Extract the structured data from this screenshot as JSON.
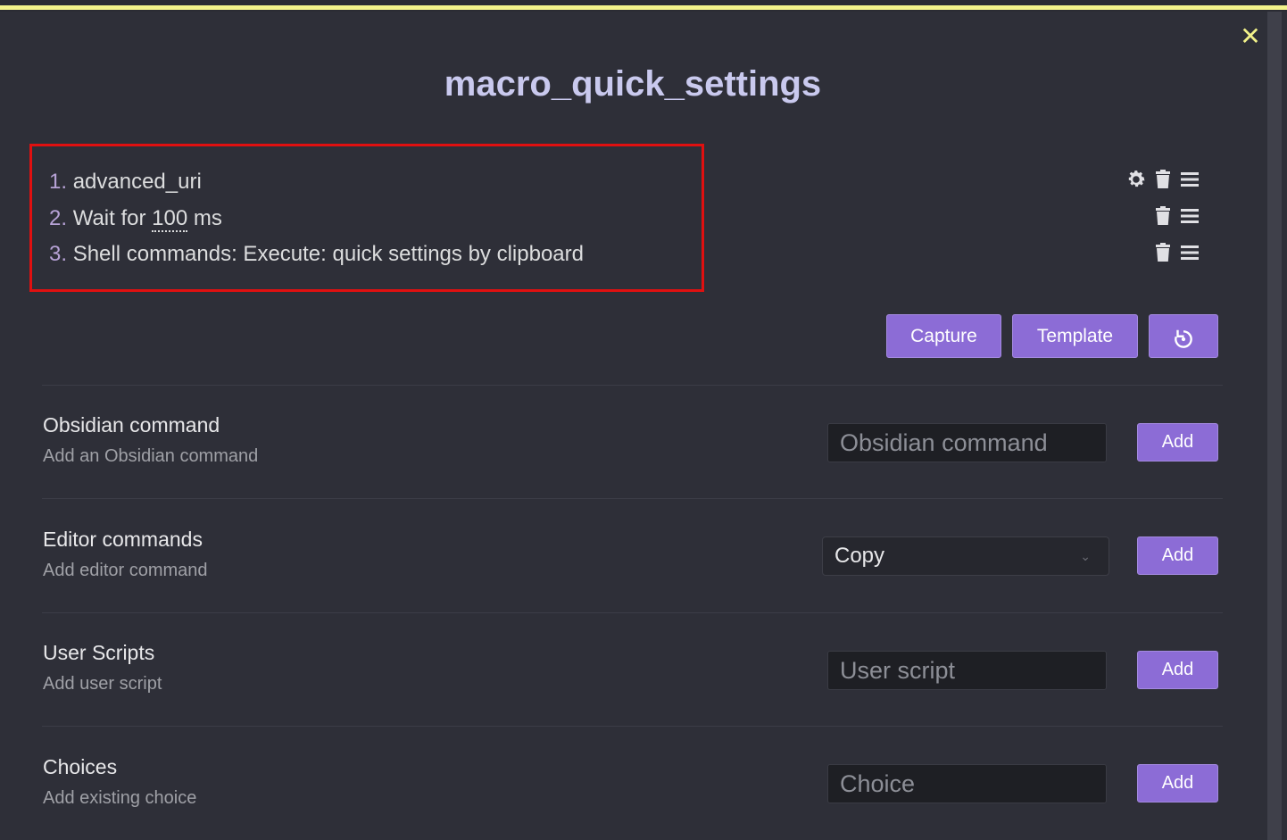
{
  "modal": {
    "title": "macro_quick_settings",
    "close_glyph": "✕"
  },
  "commands": [
    {
      "number": "1.",
      "text": "advanced_uri",
      "icons": [
        "gear-icon",
        "trash-icon",
        "drag-handle-icon"
      ]
    },
    {
      "number": "2.",
      "prefix": "Wait for ",
      "value": "100",
      "suffix": " ms",
      "icons": [
        "trash-icon",
        "drag-handle-icon"
      ]
    },
    {
      "number": "3.",
      "text": "Shell commands: Execute: quick settings by clipboard",
      "icons": [
        "trash-icon",
        "drag-handle-icon"
      ]
    }
  ],
  "actions": {
    "capture": "Capture",
    "template": "Template",
    "rotate_icon": "rotate-icon"
  },
  "settings": {
    "obsidian": {
      "name": "Obsidian command",
      "desc": "Add an Obsidian command",
      "placeholder": "Obsidian command",
      "add": "Add"
    },
    "editor": {
      "name": "Editor commands",
      "desc": "Add editor command",
      "selected": "Copy",
      "add": "Add"
    },
    "user_scripts": {
      "name": "User Scripts",
      "desc": "Add user script",
      "placeholder": "User script",
      "add": "Add"
    },
    "choices": {
      "name": "Choices",
      "desc": "Add existing choice",
      "placeholder": "Choice",
      "add": "Add"
    }
  },
  "colors": {
    "background": "#2e2f38",
    "accent": "#8c6cd6",
    "highlight_border": "#e01010",
    "top_stripe": "#f2f28a"
  }
}
